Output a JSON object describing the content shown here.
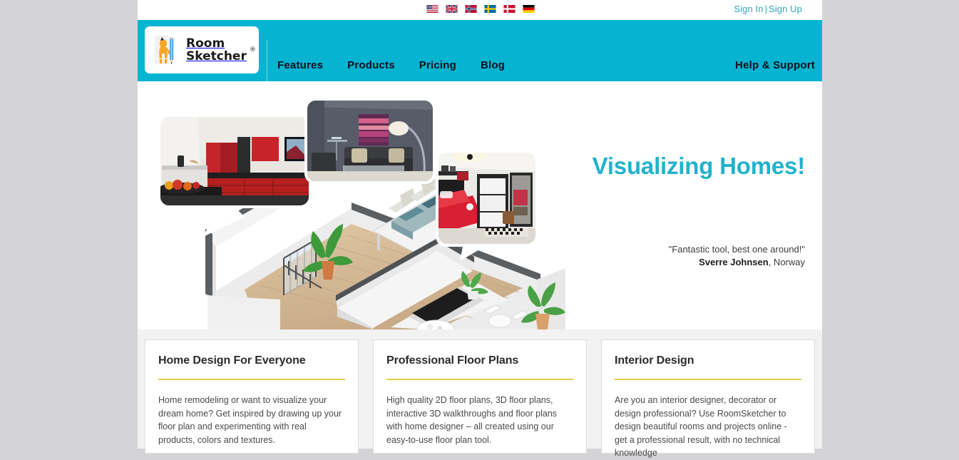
{
  "topbar": {
    "flags": [
      {
        "name": "flag-united-states",
        "label": "United States"
      },
      {
        "name": "flag-united-kingdom",
        "label": "United Kingdom"
      },
      {
        "name": "flag-norway",
        "label": "Norway"
      },
      {
        "name": "flag-sweden",
        "label": "Sweden"
      },
      {
        "name": "flag-denmark",
        "label": "Denmark"
      },
      {
        "name": "flag-germany",
        "label": "Germany"
      }
    ],
    "sign_in": "Sign In",
    "separator": "|",
    "sign_up": "Sign Up",
    "link_color": "#2fa8b8"
  },
  "header": {
    "background_color": "#06b4d1",
    "logo": {
      "line1": "Room",
      "line2": "Sketcher",
      "registered_mark": "®",
      "icon_name": "roomsketcher-mascot-with-pencil"
    },
    "nav": [
      {
        "label": "Features",
        "name": "nav-features"
      },
      {
        "label": "Products",
        "name": "nav-products"
      },
      {
        "label": "Pricing",
        "name": "nav-pricing"
      },
      {
        "label": "Blog",
        "name": "nav-blog"
      }
    ],
    "help": "Help & Support"
  },
  "hero": {
    "title": "Visualizing Homes!",
    "title_color": "#22b2cd",
    "quote": "\"Fantastic tool, best one around!\"",
    "author": "Sverre Johnsen",
    "author_location": ", Norway",
    "images": {
      "callout_kitchen": "red-kitchen-3d-render",
      "callout_living_room": "grey-living-room-3d-render",
      "callout_bedroom": "red-white-bedroom-3d-render",
      "floorplan": "3d-isometric-floor-plan-render"
    }
  },
  "cards": [
    {
      "title": "Home Design For Everyone",
      "body": "Home remodeling or want to visualize your dream home? Get inspired by drawing up your floor plan and experimenting with real products, colors and textures.",
      "name": "card-home-design"
    },
    {
      "title": "Professional Floor Plans",
      "body": "High quality 2D floor plans, 3D floor plans, interactive 3D walkthroughs and floor plans with home designer – all created using our easy-to-use floor plan tool.",
      "name": "card-floor-plans"
    },
    {
      "title": "Interior Design",
      "body": "Are you an interior designer, decorator or design professional? Use RoomSketcher to design beautiful rooms and projects online - get a professional result, with no technical knowledge",
      "name": "card-interior-design"
    }
  ],
  "theme": {
    "accent": "#06b4d1",
    "rule": "#e3cf4b",
    "page_background": "#d4d4d6",
    "section_background": "#f2f2f2"
  }
}
